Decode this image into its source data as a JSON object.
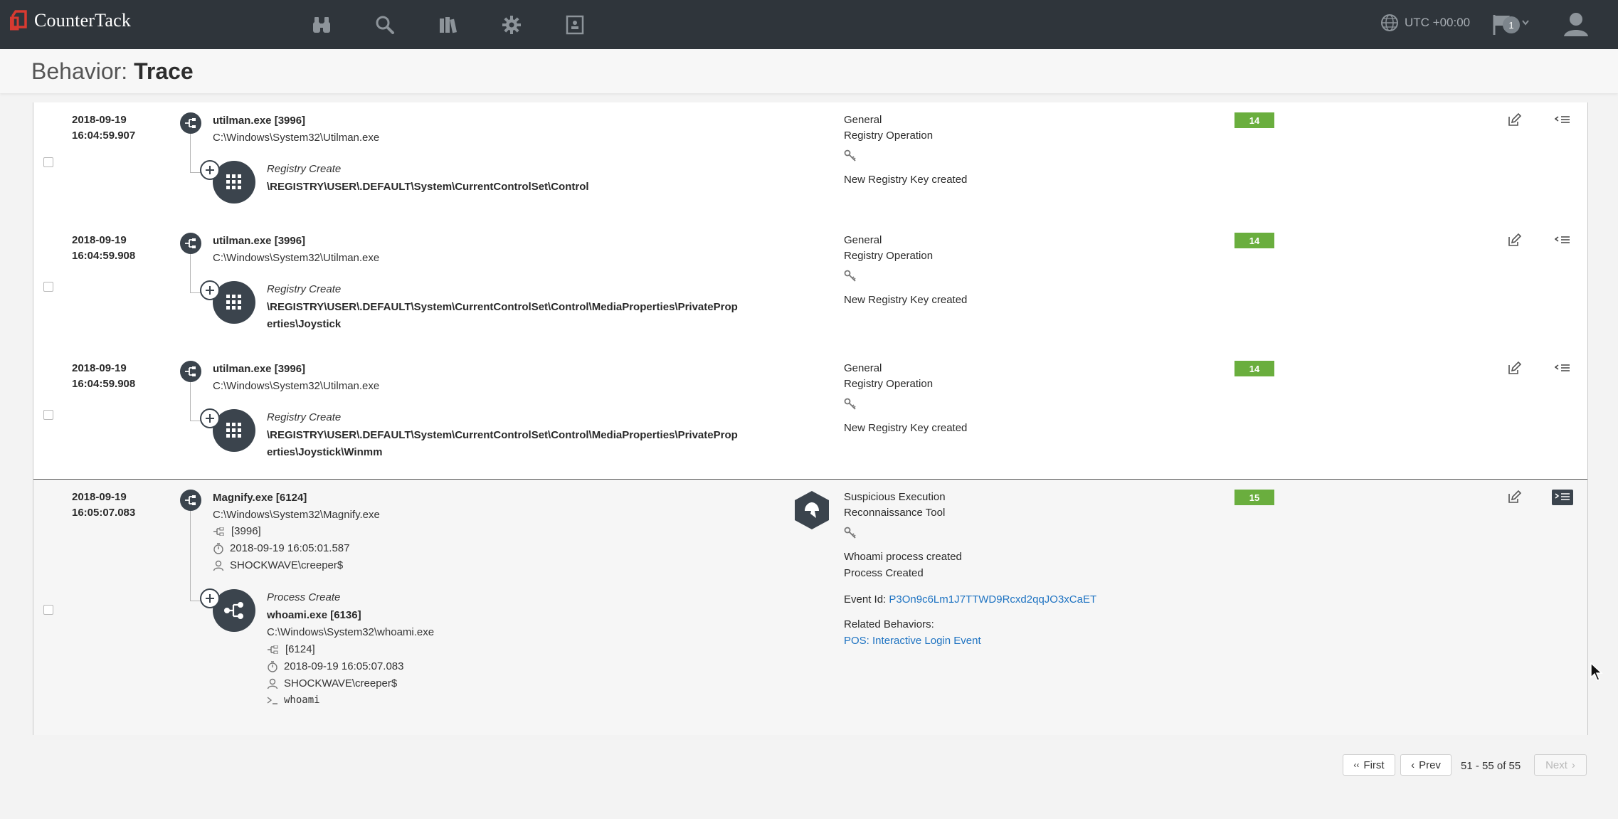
{
  "app": {
    "logo_text": "CounterTack",
    "brand_color": "#d83a31",
    "nav_icons": [
      "binoculars-icon",
      "search-icon",
      "library-icon",
      "gear-icon",
      "report-icon"
    ],
    "timezone": "UTC +00:00",
    "notification_count": "1"
  },
  "page": {
    "title_prefix": "Behavior:",
    "title_main": "Trace"
  },
  "rows": [
    {
      "date": "2018-09-19",
      "time": "16:04:59.907",
      "process": "utilman.exe [3996]",
      "path": "C:\\Windows\\System32\\Utilman.exe",
      "event_type": "Registry Create",
      "event_key": "\\REGISTRY\\USER\\.DEFAULT\\System\\CurrentControlSet\\Control",
      "category": "General",
      "subcategory": "Registry Operation",
      "description": "New Registry Key created",
      "score": "14"
    },
    {
      "date": "2018-09-19",
      "time": "16:04:59.908",
      "process": "utilman.exe [3996]",
      "path": "C:\\Windows\\System32\\Utilman.exe",
      "event_type": "Registry Create",
      "event_key": "\\REGISTRY\\USER\\.DEFAULT\\System\\CurrentControlSet\\Control\\MediaProperties\\PrivatePropertiesJoystick",
      "event_key_line1": "\\REGISTRY\\USER\\.DEFAULT\\System\\CurrentControlSet\\Control\\MediaProperties\\PrivateProp",
      "event_key_line2": "erties\\Joystick",
      "category": "General",
      "subcategory": "Registry Operation",
      "description": "New Registry Key created",
      "score": "14"
    },
    {
      "date": "2018-09-19",
      "time": "16:04:59.908",
      "process": "utilman.exe [3996]",
      "path": "C:\\Windows\\System32\\Utilman.exe",
      "event_type": "Registry Create",
      "event_key_line1": "\\REGISTRY\\USER\\.DEFAULT\\System\\CurrentControlSet\\Control\\MediaProperties\\PrivateProp",
      "event_key_line2": "erties\\Joystick\\Winmm",
      "category": "General",
      "subcategory": "Registry Operation",
      "description": "New Registry Key created",
      "score": "14"
    },
    {
      "date": "2018-09-19",
      "time": "16:05:07.083",
      "process": "Magnify.exe [6124]",
      "path": "C:\\Windows\\System32\\Magnify.exe",
      "parent_pid": "[3996]",
      "start_time": "2018-09-19 16:05:01.587",
      "user": "SHOCKWAVE\\creeper$",
      "event_type": "Process Create",
      "child_process": "whoami.exe [6136]",
      "child_path": "C:\\Windows\\System32\\whoami.exe",
      "child_parent_pid": "[6124]",
      "child_start_time": "2018-09-19 16:05:07.083",
      "child_user": "SHOCKWAVE\\creeper$",
      "child_cmd": "whoami",
      "category": "Suspicious Execution",
      "subcategory": "Reconnaissance Tool",
      "description": "Whoami process created",
      "description2": "Process Created",
      "event_id_label": "Event Id:",
      "event_id": "P3On9c6Lm1J7TTWD9Rcxd2qqJO3xCaET",
      "related_label": "Related Behaviors:",
      "related": "POS: Interactive Login Event",
      "score": "15"
    }
  ],
  "pagination": {
    "first": "First",
    "prev": "Prev",
    "info": "51 - 55 of 55",
    "next": "Next"
  },
  "colors": {
    "topbar": "#2f353b",
    "score_green": "#6aae3e",
    "link_blue": "#1e73c2",
    "icon_dark": "#3b444d"
  }
}
